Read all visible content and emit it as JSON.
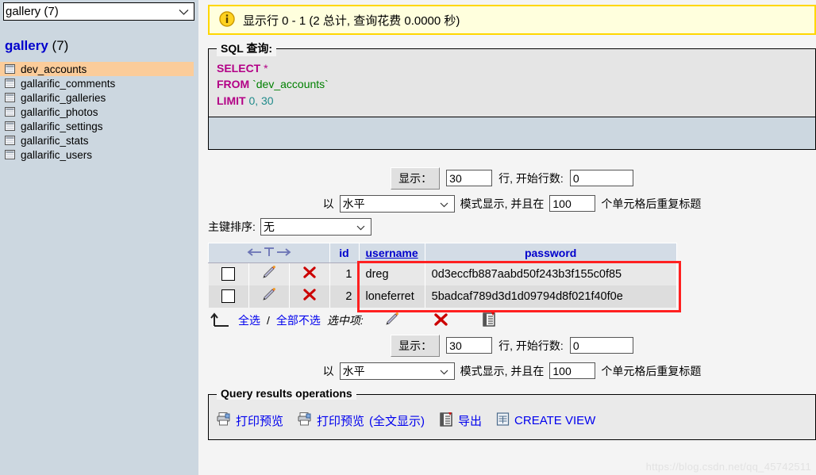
{
  "sidebar": {
    "database_select": {
      "value": "gallery (7)"
    },
    "db_title": "gallery",
    "db_count": "(7)",
    "tables": [
      {
        "name": "dev_accounts",
        "active": true
      },
      {
        "name": "gallarific_comments",
        "active": false
      },
      {
        "name": "gallarific_galleries",
        "active": false
      },
      {
        "name": "gallarific_photos",
        "active": false
      },
      {
        "name": "gallarific_settings",
        "active": false
      },
      {
        "name": "gallarific_stats",
        "active": false
      },
      {
        "name": "gallarific_users",
        "active": false
      }
    ]
  },
  "notice": {
    "text": "显示行 0 - 1 (2 总计, 查询花费 0.0000 秒)",
    "icon": "info-icon"
  },
  "sql": {
    "legend": "SQL 查询:",
    "line1_kw": "SELECT",
    "line1_star": "*",
    "line2_kw": "FROM",
    "line2_ident": "`dev_accounts`",
    "line3_kw": "LIMIT",
    "line3_a": "0",
    "line3_sep": ",",
    "line3_b": "30"
  },
  "options": {
    "show_button": "显示：",
    "rows_value": "30",
    "rows_label": "行, 开始行数:",
    "start_value": "0",
    "mode_prefix": "以",
    "mode_value": "水平",
    "mode_suffix": "模式显示, 并且在",
    "headers_value": "100",
    "headers_suffix": "个单元格后重复标题",
    "sort_label": "主键排序:",
    "sort_value": "无"
  },
  "results": {
    "sort_icon": "sort-arrows-icon",
    "columns": [
      "id",
      "username",
      "password"
    ],
    "rows": [
      {
        "id": "1",
        "username": "dreg",
        "password": "0d3eccfb887aabd50f243b3f155c0f85"
      },
      {
        "id": "2",
        "username": "loneferret",
        "password": "5badcaf789d3d1d09794d8f021f40f0e"
      }
    ],
    "select_all": "全选",
    "separator": "/",
    "unselect_all": "全部不选",
    "with_selected": "选中项:",
    "highlight_color": "#ff2020"
  },
  "query_ops": {
    "legend": "Query results operations",
    "items": [
      {
        "label": "打印预览",
        "suffix": "",
        "icon": "printer-icon"
      },
      {
        "label": "打印预览",
        "suffix": "(全文显示)",
        "icon": "printer-icon"
      },
      {
        "label": "导出",
        "suffix": "",
        "icon": "export-icon"
      },
      {
        "label": "CREATE VIEW",
        "suffix": "",
        "icon": "view-icon"
      }
    ]
  },
  "watermark": "https://blog.csdn.net/qq_45742511"
}
